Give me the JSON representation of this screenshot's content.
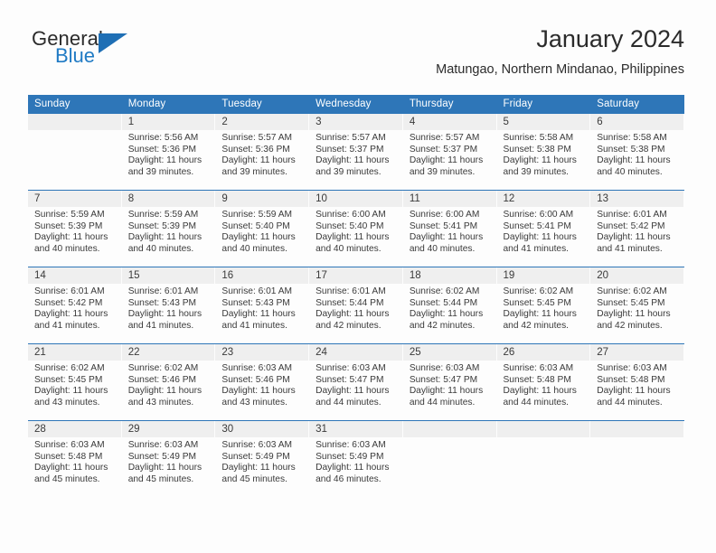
{
  "brand": {
    "name_top": "General",
    "name_bottom": "Blue",
    "accent_color": "#1f7ac4",
    "header_color": "#2e76b8"
  },
  "header": {
    "title": "January 2024",
    "subtitle": "Matungao, Northern Mindanao, Philippines"
  },
  "weekdays": [
    "Sunday",
    "Monday",
    "Tuesday",
    "Wednesday",
    "Thursday",
    "Friday",
    "Saturday"
  ],
  "labels": {
    "sunrise": "Sunrise:",
    "sunset": "Sunset:",
    "daylight": "Daylight:"
  },
  "weeks": [
    [
      {
        "day": "",
        "sunrise": "",
        "sunset": "",
        "daylight": "",
        "empty": true
      },
      {
        "day": "1",
        "sunrise": "Sunrise: 5:56 AM",
        "sunset": "Sunset: 5:36 PM",
        "daylight": "Daylight: 11 hours and 39 minutes."
      },
      {
        "day": "2",
        "sunrise": "Sunrise: 5:57 AM",
        "sunset": "Sunset: 5:36 PM",
        "daylight": "Daylight: 11 hours and 39 minutes."
      },
      {
        "day": "3",
        "sunrise": "Sunrise: 5:57 AM",
        "sunset": "Sunset: 5:37 PM",
        "daylight": "Daylight: 11 hours and 39 minutes."
      },
      {
        "day": "4",
        "sunrise": "Sunrise: 5:57 AM",
        "sunset": "Sunset: 5:37 PM",
        "daylight": "Daylight: 11 hours and 39 minutes."
      },
      {
        "day": "5",
        "sunrise": "Sunrise: 5:58 AM",
        "sunset": "Sunset: 5:38 PM",
        "daylight": "Daylight: 11 hours and 39 minutes."
      },
      {
        "day": "6",
        "sunrise": "Sunrise: 5:58 AM",
        "sunset": "Sunset: 5:38 PM",
        "daylight": "Daylight: 11 hours and 40 minutes."
      }
    ],
    [
      {
        "day": "7",
        "sunrise": "Sunrise: 5:59 AM",
        "sunset": "Sunset: 5:39 PM",
        "daylight": "Daylight: 11 hours and 40 minutes."
      },
      {
        "day": "8",
        "sunrise": "Sunrise: 5:59 AM",
        "sunset": "Sunset: 5:39 PM",
        "daylight": "Daylight: 11 hours and 40 minutes."
      },
      {
        "day": "9",
        "sunrise": "Sunrise: 5:59 AM",
        "sunset": "Sunset: 5:40 PM",
        "daylight": "Daylight: 11 hours and 40 minutes."
      },
      {
        "day": "10",
        "sunrise": "Sunrise: 6:00 AM",
        "sunset": "Sunset: 5:40 PM",
        "daylight": "Daylight: 11 hours and 40 minutes."
      },
      {
        "day": "11",
        "sunrise": "Sunrise: 6:00 AM",
        "sunset": "Sunset: 5:41 PM",
        "daylight": "Daylight: 11 hours and 40 minutes."
      },
      {
        "day": "12",
        "sunrise": "Sunrise: 6:00 AM",
        "sunset": "Sunset: 5:41 PM",
        "daylight": "Daylight: 11 hours and 41 minutes."
      },
      {
        "day": "13",
        "sunrise": "Sunrise: 6:01 AM",
        "sunset": "Sunset: 5:42 PM",
        "daylight": "Daylight: 11 hours and 41 minutes."
      }
    ],
    [
      {
        "day": "14",
        "sunrise": "Sunrise: 6:01 AM",
        "sunset": "Sunset: 5:42 PM",
        "daylight": "Daylight: 11 hours and 41 minutes."
      },
      {
        "day": "15",
        "sunrise": "Sunrise: 6:01 AM",
        "sunset": "Sunset: 5:43 PM",
        "daylight": "Daylight: 11 hours and 41 minutes."
      },
      {
        "day": "16",
        "sunrise": "Sunrise: 6:01 AM",
        "sunset": "Sunset: 5:43 PM",
        "daylight": "Daylight: 11 hours and 41 minutes."
      },
      {
        "day": "17",
        "sunrise": "Sunrise: 6:01 AM",
        "sunset": "Sunset: 5:44 PM",
        "daylight": "Daylight: 11 hours and 42 minutes."
      },
      {
        "day": "18",
        "sunrise": "Sunrise: 6:02 AM",
        "sunset": "Sunset: 5:44 PM",
        "daylight": "Daylight: 11 hours and 42 minutes."
      },
      {
        "day": "19",
        "sunrise": "Sunrise: 6:02 AM",
        "sunset": "Sunset: 5:45 PM",
        "daylight": "Daylight: 11 hours and 42 minutes."
      },
      {
        "day": "20",
        "sunrise": "Sunrise: 6:02 AM",
        "sunset": "Sunset: 5:45 PM",
        "daylight": "Daylight: 11 hours and 42 minutes."
      }
    ],
    [
      {
        "day": "21",
        "sunrise": "Sunrise: 6:02 AM",
        "sunset": "Sunset: 5:45 PM",
        "daylight": "Daylight: 11 hours and 43 minutes."
      },
      {
        "day": "22",
        "sunrise": "Sunrise: 6:02 AM",
        "sunset": "Sunset: 5:46 PM",
        "daylight": "Daylight: 11 hours and 43 minutes."
      },
      {
        "day": "23",
        "sunrise": "Sunrise: 6:03 AM",
        "sunset": "Sunset: 5:46 PM",
        "daylight": "Daylight: 11 hours and 43 minutes."
      },
      {
        "day": "24",
        "sunrise": "Sunrise: 6:03 AM",
        "sunset": "Sunset: 5:47 PM",
        "daylight": "Daylight: 11 hours and 44 minutes."
      },
      {
        "day": "25",
        "sunrise": "Sunrise: 6:03 AM",
        "sunset": "Sunset: 5:47 PM",
        "daylight": "Daylight: 11 hours and 44 minutes."
      },
      {
        "day": "26",
        "sunrise": "Sunrise: 6:03 AM",
        "sunset": "Sunset: 5:48 PM",
        "daylight": "Daylight: 11 hours and 44 minutes."
      },
      {
        "day": "27",
        "sunrise": "Sunrise: 6:03 AM",
        "sunset": "Sunset: 5:48 PM",
        "daylight": "Daylight: 11 hours and 44 minutes."
      }
    ],
    [
      {
        "day": "28",
        "sunrise": "Sunrise: 6:03 AM",
        "sunset": "Sunset: 5:48 PM",
        "daylight": "Daylight: 11 hours and 45 minutes."
      },
      {
        "day": "29",
        "sunrise": "Sunrise: 6:03 AM",
        "sunset": "Sunset: 5:49 PM",
        "daylight": "Daylight: 11 hours and 45 minutes."
      },
      {
        "day": "30",
        "sunrise": "Sunrise: 6:03 AM",
        "sunset": "Sunset: 5:49 PM",
        "daylight": "Daylight: 11 hours and 45 minutes."
      },
      {
        "day": "31",
        "sunrise": "Sunrise: 6:03 AM",
        "sunset": "Sunset: 5:49 PM",
        "daylight": "Daylight: 11 hours and 46 minutes."
      },
      {
        "day": "",
        "sunrise": "",
        "sunset": "",
        "daylight": "",
        "empty": true
      },
      {
        "day": "",
        "sunrise": "",
        "sunset": "",
        "daylight": "",
        "empty": true
      },
      {
        "day": "",
        "sunrise": "",
        "sunset": "",
        "daylight": "",
        "empty": true
      }
    ]
  ]
}
